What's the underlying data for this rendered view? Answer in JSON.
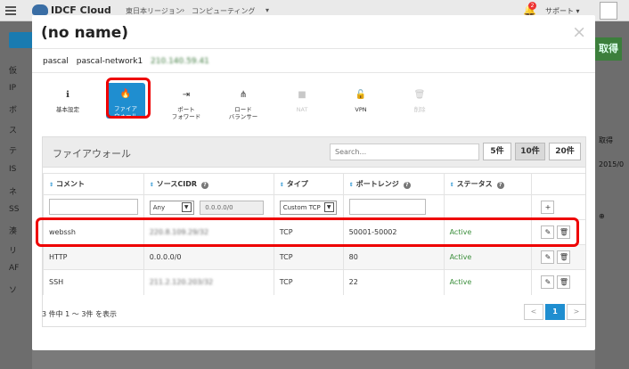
{
  "header": {
    "brand": "IDCF Cloud",
    "breadcrumb": [
      "東日本リージョン",
      "›",
      "コンピューティング",
      "▾"
    ],
    "notification_count": "2",
    "support_label": "サポート ▾"
  },
  "sidebar": {
    "items": [
      "仮",
      "IP",
      "ボ",
      "ス",
      "テ",
      "IS",
      "ネ",
      "SS",
      "湊",
      "リ",
      "AF",
      "ソ"
    ]
  },
  "background_right": {
    "button_label": "取得",
    "texts": [
      "取得",
      "2015/0",
      "⊕"
    ]
  },
  "modal": {
    "title": "(no name)",
    "close_label": "×",
    "info": {
      "name": "pascal",
      "network": "pascal-network1",
      "ip": "210.140.59.41"
    },
    "tools": [
      {
        "label": "基本設定",
        "icon": "info-icon",
        "glyph": "ℹ",
        "state": "normal"
      },
      {
        "label": "ファイア\nウォール",
        "icon": "fire-icon",
        "glyph": "🔥",
        "state": "active"
      },
      {
        "label": "ポート\nフォワード",
        "icon": "sign-in-icon",
        "glyph": "⇥",
        "state": "normal"
      },
      {
        "label": "ロード\nバランサー",
        "icon": "sitemap-icon",
        "glyph": "⋔",
        "state": "normal"
      },
      {
        "label": "NAT",
        "icon": "stop-icon",
        "glyph": "■",
        "state": "disabled"
      },
      {
        "label": "VPN",
        "icon": "unlock-icon",
        "glyph": "🔓",
        "state": "normal"
      },
      {
        "label": "削除",
        "icon": "trash-icon",
        "glyph": "🗑",
        "state": "disabled"
      }
    ]
  },
  "panel": {
    "title": "ファイアウォール",
    "search_placeholder": "Search...",
    "page_sizes": [
      "5件",
      "10件",
      "20件"
    ],
    "selected_page_size": "10件",
    "columns": [
      "コメント",
      "ソースCIDR",
      "タイプ",
      "ポートレンジ",
      "ステータス"
    ],
    "filter": {
      "cidr_select": "Any",
      "cidr_value": "0.0.0.0/0",
      "type_select": "Custom TCP",
      "add_label": "+"
    },
    "rows": [
      {
        "comment": "webssh",
        "cidr": "220.8.109.29/32",
        "type": "TCP",
        "port": "50001-50002",
        "status": "Active"
      },
      {
        "comment": "HTTP",
        "cidr": "0.0.0.0/0",
        "type": "TCP",
        "port": "80",
        "status": "Active"
      },
      {
        "comment": "SSH",
        "cidr": "211.2.120.203/32",
        "type": "TCP",
        "port": "22",
        "status": "Active"
      }
    ],
    "summary": "3 件中 1 ～ 3件 を表示",
    "pager": {
      "prev": "<",
      "current": "1",
      "next": ">"
    }
  },
  "colors": {
    "accent": "#1f8ed0",
    "highlight": "#ee0000",
    "active_status": "#3c8f3c"
  }
}
